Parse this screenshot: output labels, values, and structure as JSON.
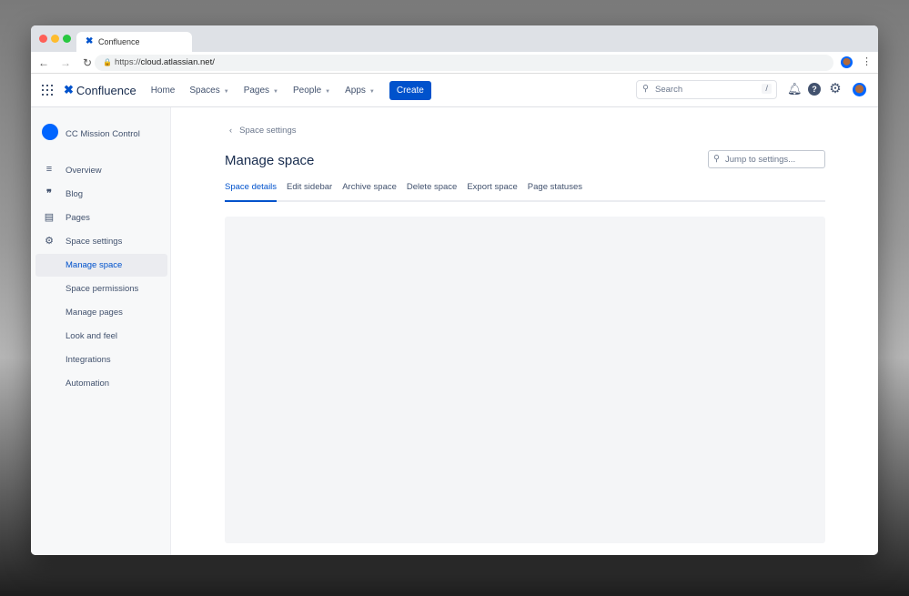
{
  "browser": {
    "tab_title": "Confluence",
    "url_prefix": "https://",
    "url_host": "cloud.atlassian.net/"
  },
  "nav": {
    "brand": "Confluence",
    "items": [
      {
        "label": "Home"
      },
      {
        "label": "Spaces",
        "dropdown": true
      },
      {
        "label": "Pages",
        "dropdown": true
      },
      {
        "label": "People",
        "dropdown": true
      },
      {
        "label": "Apps",
        "dropdown": true
      }
    ],
    "create": "Create",
    "search_placeholder": "Search",
    "search_shortcut": "/"
  },
  "sidebar": {
    "space_name": "CC Mission Control",
    "items": [
      {
        "label": "Overview",
        "icon": "lines-icon"
      },
      {
        "label": "Blog",
        "icon": "quote-icon"
      },
      {
        "label": "Pages",
        "icon": "page-icon"
      },
      {
        "label": "Space settings",
        "icon": "gear-icon"
      },
      {
        "label": "Manage space",
        "active": true
      },
      {
        "label": "Space permissions"
      },
      {
        "label": "Manage pages"
      },
      {
        "label": "Look and feel"
      },
      {
        "label": "Integrations"
      },
      {
        "label": "Automation"
      }
    ]
  },
  "main": {
    "breadcrumb": "Space settings",
    "title": "Manage space",
    "jump_placeholder": "Jump to settings...",
    "tabs": [
      "Space details",
      "Edit sidebar",
      "Archive space",
      "Delete space",
      "Export space",
      "Page statuses"
    ]
  },
  "colors": {
    "accent": "#0052cc"
  }
}
